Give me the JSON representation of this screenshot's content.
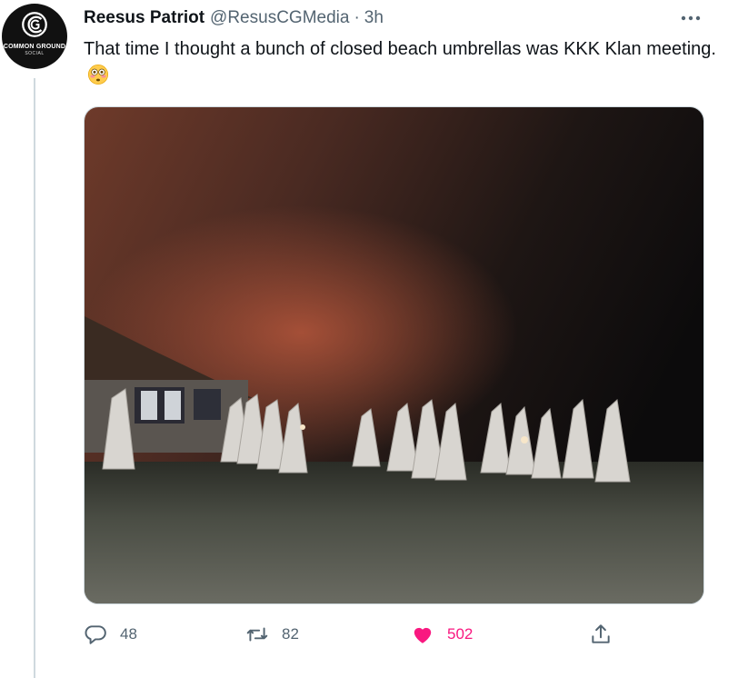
{
  "author": {
    "name": "Reesus Patriot",
    "handle": "@ResusCGMedia",
    "separator": "·",
    "time": "3h",
    "avatar_brand": "COMMON GROUND",
    "avatar_sub": "SOCIAL"
  },
  "tweet": {
    "text": "That time I thought a bunch of closed beach umbrellas was KKK Klan meeting.",
    "emoji": "flushed-face-emoji"
  },
  "actions": {
    "reply_count": "48",
    "retweet_count": "82",
    "like_count": "502",
    "like_color": "#f91880"
  },
  "icons": {
    "more": "more-dots-icon",
    "reply": "reply-icon",
    "retweet": "retweet-icon",
    "like": "heart-icon",
    "share": "share-icon"
  }
}
